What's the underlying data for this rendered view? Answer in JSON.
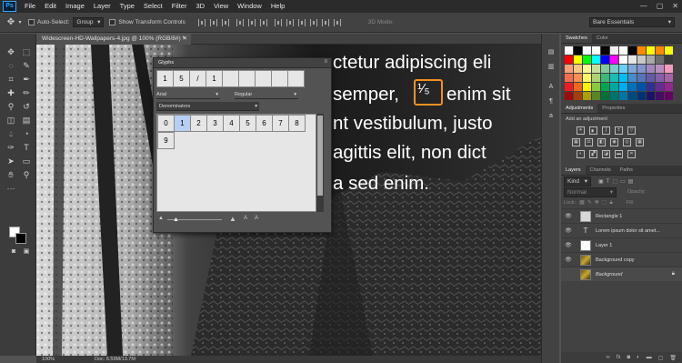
{
  "app": {
    "logo": "Ps"
  },
  "menubar": {
    "items": [
      "File",
      "Edit",
      "Image",
      "Layer",
      "Type",
      "Select",
      "Filter",
      "3D",
      "View",
      "Window",
      "Help"
    ],
    "controls": [
      "—",
      "▢",
      "✕"
    ]
  },
  "options": {
    "auto_select_label": "Auto-Select:",
    "auto_select_target": "Group",
    "transform_label": "Show Transform Controls",
    "mode_3d": "3D Mode:",
    "workspace": "Bare Essentials"
  },
  "document": {
    "tab_title": "Widescreen-HD-Wallpapers-4.jpg @ 100% (RGB/8#) *",
    "status_zoom": "100%",
    "status_doc": "Doc: 6.59M/13.7M"
  },
  "canvas_text": {
    "lines": [
      "ctetur adipiscing eli",
      "semper,",
      "enim sit",
      "nt vestibulum, justo",
      "agittis elit, non dict",
      "a sed enim."
    ],
    "fraction": "¹⁄₅"
  },
  "glyphs": {
    "title": "Glyphs",
    "recent": [
      "1",
      "5",
      "/",
      "1",
      "",
      "",
      "",
      "",
      ""
    ],
    "font_family": "Arial",
    "font_style": "Regular",
    "show": "Denominators",
    "grid": [
      "0",
      "1",
      "2",
      "3",
      "4",
      "5",
      "6",
      "7",
      "8",
      "9"
    ],
    "selected_index": 1
  },
  "swatches": {
    "tabs": [
      "Swatches",
      "Color"
    ],
    "colors": [
      "#ffffff",
      "#000000",
      "#ffffff",
      "#ffffff",
      "#000000",
      "#f0f0f0",
      "#ffffff",
      "#000000",
      "#ff8a00",
      "#fcff00",
      "#ff8a00",
      "#fcff00",
      "#ff0000",
      "#ffff00",
      "#00ff00",
      "#00ffff",
      "#0000ff",
      "#ff00ff",
      "#ffffff",
      "#e6e6e6",
      "#c8c8c8",
      "#a8a8a8",
      "#6e6e6e",
      "#3a3a3a",
      "#f79f7a",
      "#fbc683",
      "#fff799",
      "#c4df9b",
      "#82ca9c",
      "#7accc8",
      "#6dcff6",
      "#7ea7d8",
      "#8493ca",
      "#a187be",
      "#bc8dbf",
      "#f49ac1",
      "#f26c4f",
      "#f68e55",
      "#fff467",
      "#acd372",
      "#3cb878",
      "#1cbbb4",
      "#00bff3",
      "#448ccb",
      "#5574b9",
      "#605ca8",
      "#855fa8",
      "#a763a8",
      "#ed1c24",
      "#f26522",
      "#fff200",
      "#8dc73f",
      "#00a651",
      "#00a99d",
      "#00aeef",
      "#0072bc",
      "#0054a6",
      "#2e3192",
      "#662d91",
      "#92278f",
      "#9e0b0f",
      "#a0410d",
      "#aba000",
      "#598527",
      "#007236",
      "#00746b",
      "#0076a3",
      "#004a80",
      "#003471",
      "#1b1464",
      "#440e62",
      "#630460"
    ]
  },
  "adjustments": {
    "tabs": [
      "Adjustments",
      "Properties"
    ],
    "label": "Add an adjustment",
    "icons_row1": [
      "brightness-icon",
      "levels-icon",
      "curves-icon",
      "exposure-icon",
      "vibrance-icon"
    ],
    "icons_row2": [
      "hue-icon",
      "balance-icon",
      "bw-icon",
      "photo-filter-icon",
      "mixer-icon",
      "lookup-icon"
    ],
    "icons_row3": [
      "invert-icon",
      "posterize-icon",
      "threshold-icon",
      "gradient-map-icon",
      "selective-color-icon"
    ]
  },
  "layers": {
    "tabs": [
      "Layers",
      "Channels",
      "Paths"
    ],
    "kind": "Kind",
    "blend": "Normal",
    "opacity_label": "Opacity:",
    "lock_label": "Lock:",
    "fill_label": "Fill:",
    "items": [
      {
        "name": "Rectangle 1",
        "type": "shape"
      },
      {
        "name": "Lorem ipsum dolor sit amet...",
        "type": "text"
      },
      {
        "name": "Layer 1",
        "type": "pixel"
      },
      {
        "name": "Background copy",
        "type": "image"
      },
      {
        "name": "Background",
        "type": "image-locked"
      }
    ],
    "footer_icons": [
      "link-icon",
      "fx-icon",
      "mask-icon",
      "adjustment-icon",
      "folder-icon",
      "new-layer-icon",
      "trash-icon"
    ]
  }
}
